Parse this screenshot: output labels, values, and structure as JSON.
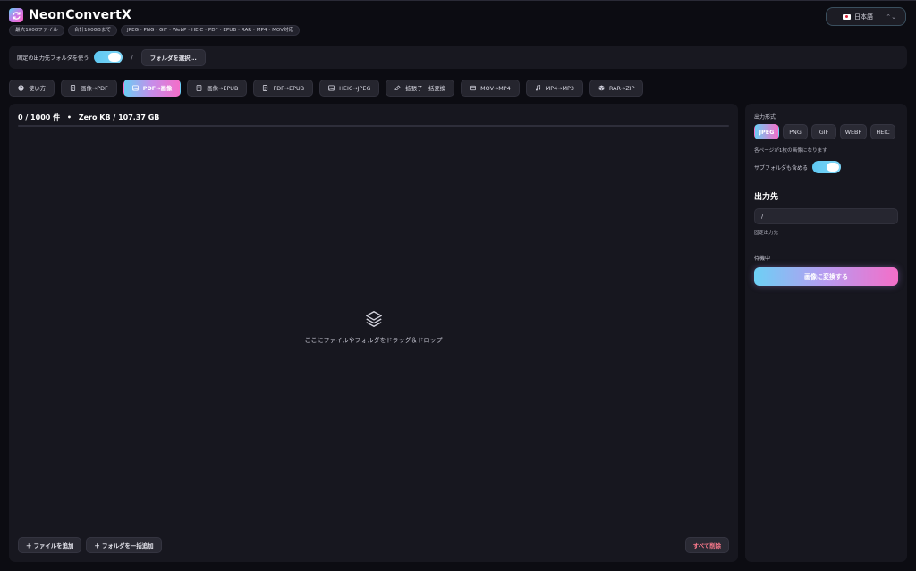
{
  "header": {
    "title": "NeonConvertX",
    "badges": [
      "最大1000ファイル",
      "合計100GBまで",
      "JPEG・PNG・GIF・WebP・HEIC・PDF・EPUB・RAR・MP4・MOV対応"
    ]
  },
  "language": {
    "label": "日本語"
  },
  "output_bar": {
    "fixed_folder_label": "固定の出力先フォルダを使う",
    "fixed_folder_enabled": true,
    "separator": "/",
    "select_folder_label": "フォルダを選択..."
  },
  "tabs": [
    {
      "label": "使い方",
      "icon": "help-icon",
      "active": false
    },
    {
      "label": "画像→PDF",
      "icon": "document-icon",
      "active": false
    },
    {
      "label": "PDF→画像",
      "icon": "image-icon",
      "active": true
    },
    {
      "label": "画像→EPUB",
      "icon": "book-icon",
      "active": false
    },
    {
      "label": "PDF→EPUB",
      "icon": "document-icon",
      "active": false
    },
    {
      "label": "HEIC→JPEG",
      "icon": "image-icon",
      "active": false
    },
    {
      "label": "拡張子一括変換",
      "icon": "rename-icon",
      "active": false
    },
    {
      "label": "MOV→MP4",
      "icon": "video-icon",
      "active": false
    },
    {
      "label": "MP4→MP3",
      "icon": "music-icon",
      "active": false
    },
    {
      "label": "RAR→ZIP",
      "icon": "archive-icon",
      "active": false
    }
  ],
  "main": {
    "count_text": "0 / 1000 件",
    "bullet": "•",
    "size_text": "Zero KB / 107.37 GB",
    "progress": 0,
    "drop_text": "ここにファイルやフォルダをドラッグ＆ドロップ",
    "add_files_label": "＋ ファイルを追加",
    "add_folder_label": "＋ フォルダを一括追加",
    "clear_all_label": "すべて削除"
  },
  "side": {
    "format_label": "出力形式",
    "formats": [
      "JPEG",
      "PNG",
      "GIF",
      "WEBP",
      "HEIC"
    ],
    "selected_format": "JPEG",
    "page_note": "各ページが1枚の画像になります",
    "subfolder_label": "サブフォルダも含める",
    "subfolder_enabled": true,
    "output_heading": "出力先",
    "output_path": "/",
    "output_sub": "固定出力先",
    "status": "待機中",
    "convert_label": "画像に変換する"
  },
  "colors": {
    "accent_cyan": "#6ccdf4",
    "accent_pink": "#f46ec8",
    "danger": "#ff7b8e",
    "background": "#0c0c12",
    "panel": "#17171f"
  }
}
